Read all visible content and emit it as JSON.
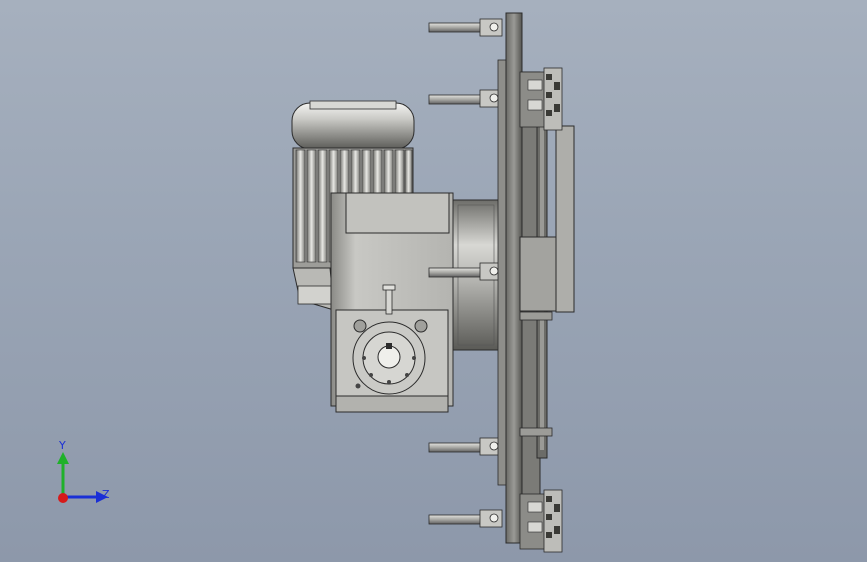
{
  "viewport": {
    "background_top": "#a6b0be",
    "background_bottom": "#8d98aa"
  },
  "model": {
    "name_icon": "gear-motor-assembly"
  },
  "triad": {
    "y_label": "Y",
    "z_label": "Z",
    "y_color": "#1fb12a",
    "z_color": "#1a2fd6",
    "origin_color": "#d61a1a"
  }
}
